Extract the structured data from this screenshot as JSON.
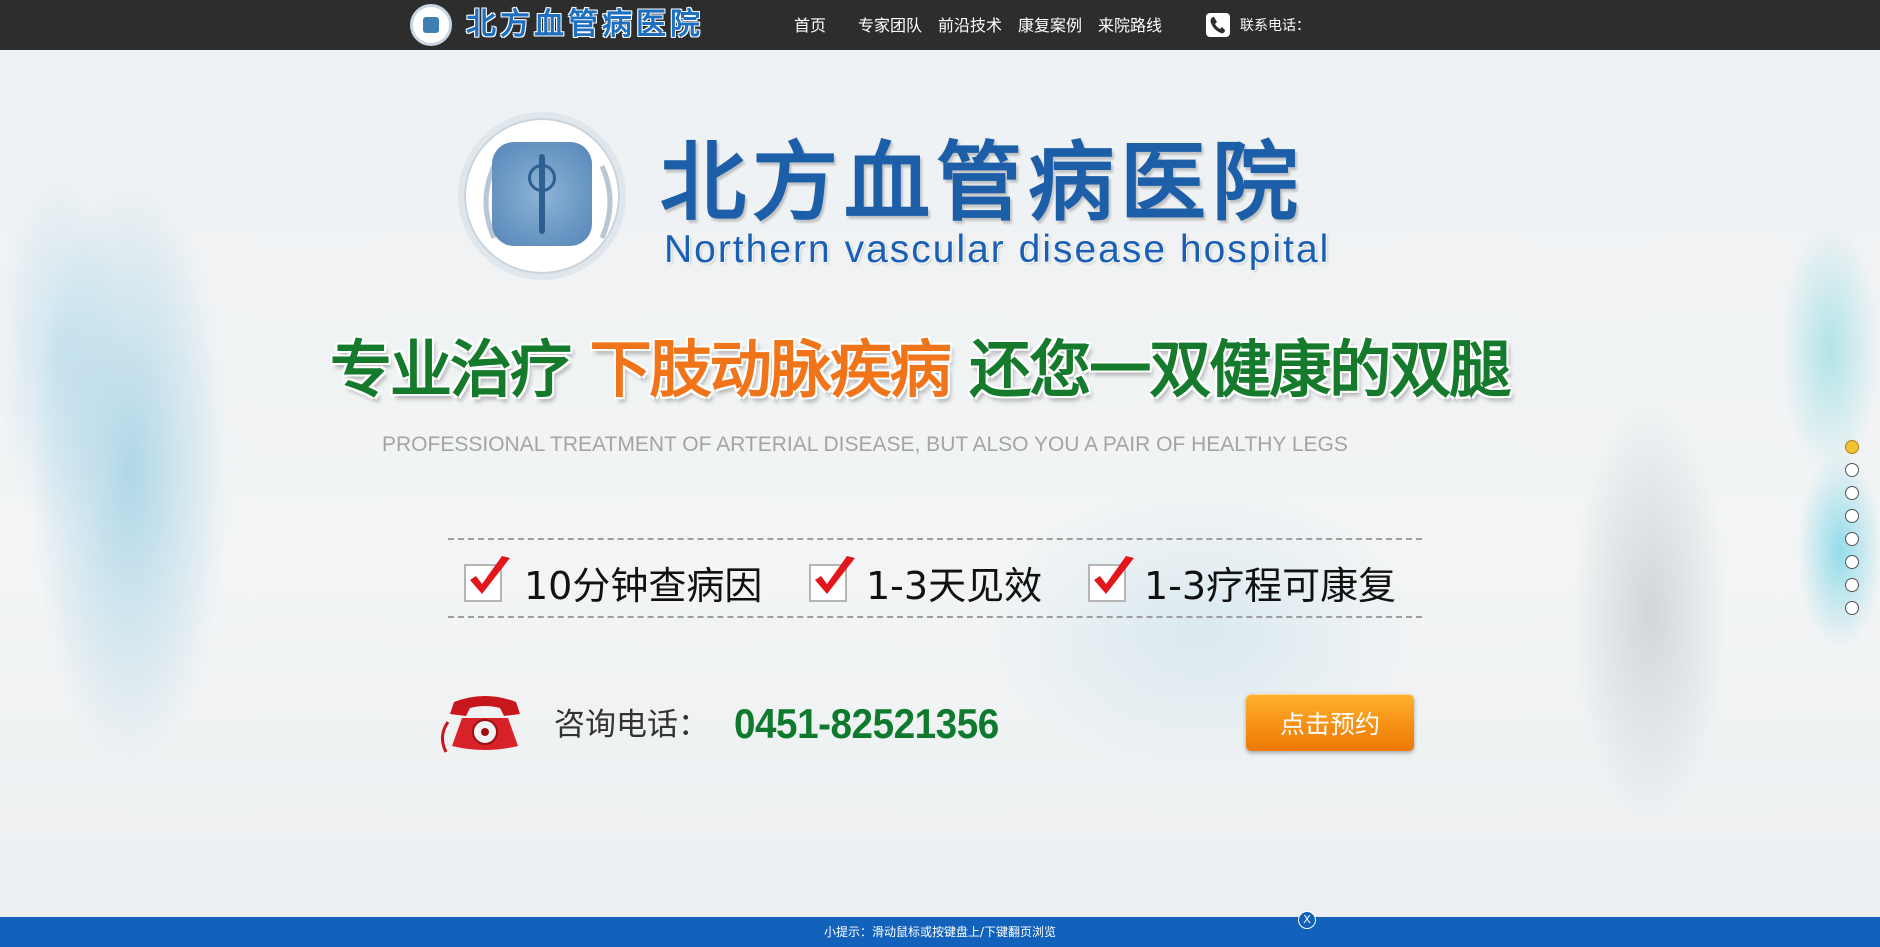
{
  "topbar": {
    "brand": "北方血管病医院",
    "nav": [
      {
        "label": "首页"
      },
      {
        "label": "专家团队"
      },
      {
        "label": "前沿技术"
      },
      {
        "label": "康复案例"
      },
      {
        "label": "来院路线"
      }
    ],
    "contact_label": "联系电话："
  },
  "hero": {
    "hospital_name_cn": "北方血管病医院",
    "hospital_name_en": "Northern vascular disease hospital",
    "slogan_part1": "专业治疗 ",
    "slogan_part2": "下肢动脉疾病",
    "slogan_part3": " 还您一双健康的双腿",
    "slogan_en": "PROFESSIONAL TREATMENT OF ARTERIAL DISEASE, BUT ALSO YOU A PAIR OF HEALTHY LEGS",
    "features": [
      {
        "text": "10分钟查病因"
      },
      {
        "text": "1-3天见效"
      },
      {
        "text": "1-3疗程可康复"
      }
    ],
    "consult_label": "咨询电话：",
    "consult_phone": "0451-82521356",
    "book_button": "点击预约"
  },
  "pager": {
    "count": 8,
    "active_index": 0
  },
  "bottombar": {
    "tip": "小提示：滑动鼠标或按键盘上/下键翻页浏览",
    "close_label": "X"
  },
  "colors": {
    "topbar_bg": "#2d2d2d",
    "bottombar_bg": "#1261ba",
    "brand_blue": "#1d5ea8",
    "slogan_green": "#157a2c",
    "slogan_orange": "#f0741a",
    "phone_green": "#0f7a2e",
    "button_orange": "#f79014",
    "dot_active": "#f1c232"
  }
}
